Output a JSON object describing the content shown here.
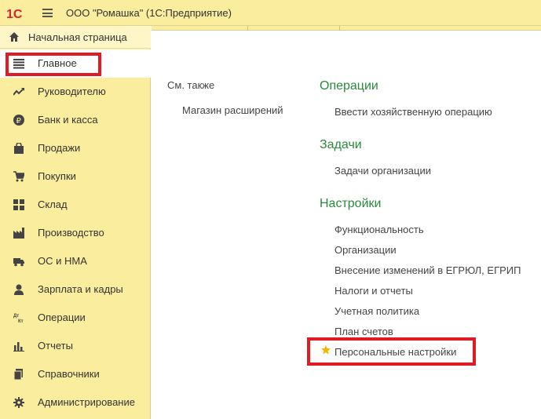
{
  "app": {
    "title": "ООО \"Ромашка\"  (1С:Предприятие)",
    "logo_label": "1С"
  },
  "sidebar": {
    "home_label": "Начальная страница",
    "items": [
      {
        "label": "Главное",
        "icon": "list-icon"
      },
      {
        "label": "Руководителю",
        "icon": "trend-icon"
      },
      {
        "label": "Банк и касса",
        "icon": "ruble-icon"
      },
      {
        "label": "Продажи",
        "icon": "shopping-bag-icon"
      },
      {
        "label": "Покупки",
        "icon": "cart-icon"
      },
      {
        "label": "Склад",
        "icon": "warehouse-icon"
      },
      {
        "label": "Производство",
        "icon": "factory-icon"
      },
      {
        "label": "ОС и НМА",
        "icon": "truck-icon"
      },
      {
        "label": "Зарплата и кадры",
        "icon": "person-icon"
      },
      {
        "label": "Операции",
        "icon": "debit-credit-icon"
      },
      {
        "label": "Отчеты",
        "icon": "bar-chart-icon"
      },
      {
        "label": "Справочники",
        "icon": "books-icon"
      },
      {
        "label": "Администрирование",
        "icon": "gear-icon"
      }
    ]
  },
  "content": {
    "see_also_label": "См. также",
    "see_also_link": "Магазин расширений",
    "sections": [
      {
        "title": "Операции",
        "links": [
          "Ввести хозяйственную операцию"
        ]
      },
      {
        "title": "Задачи",
        "links": [
          "Задачи организации"
        ]
      },
      {
        "title": "Настройки",
        "links": [
          "Функциональность",
          "Организации",
          "Внесение изменений в ЕГРЮЛ, ЕГРИП",
          "Налоги и отчеты",
          "Учетная политика",
          "План счетов",
          "Персональные настройки"
        ]
      }
    ]
  },
  "colors": {
    "panel_yellow": "#fbed9e",
    "section_green": "#2a8a3c",
    "highlight_red": "#e01b24",
    "star_gold": "#f5b400"
  }
}
